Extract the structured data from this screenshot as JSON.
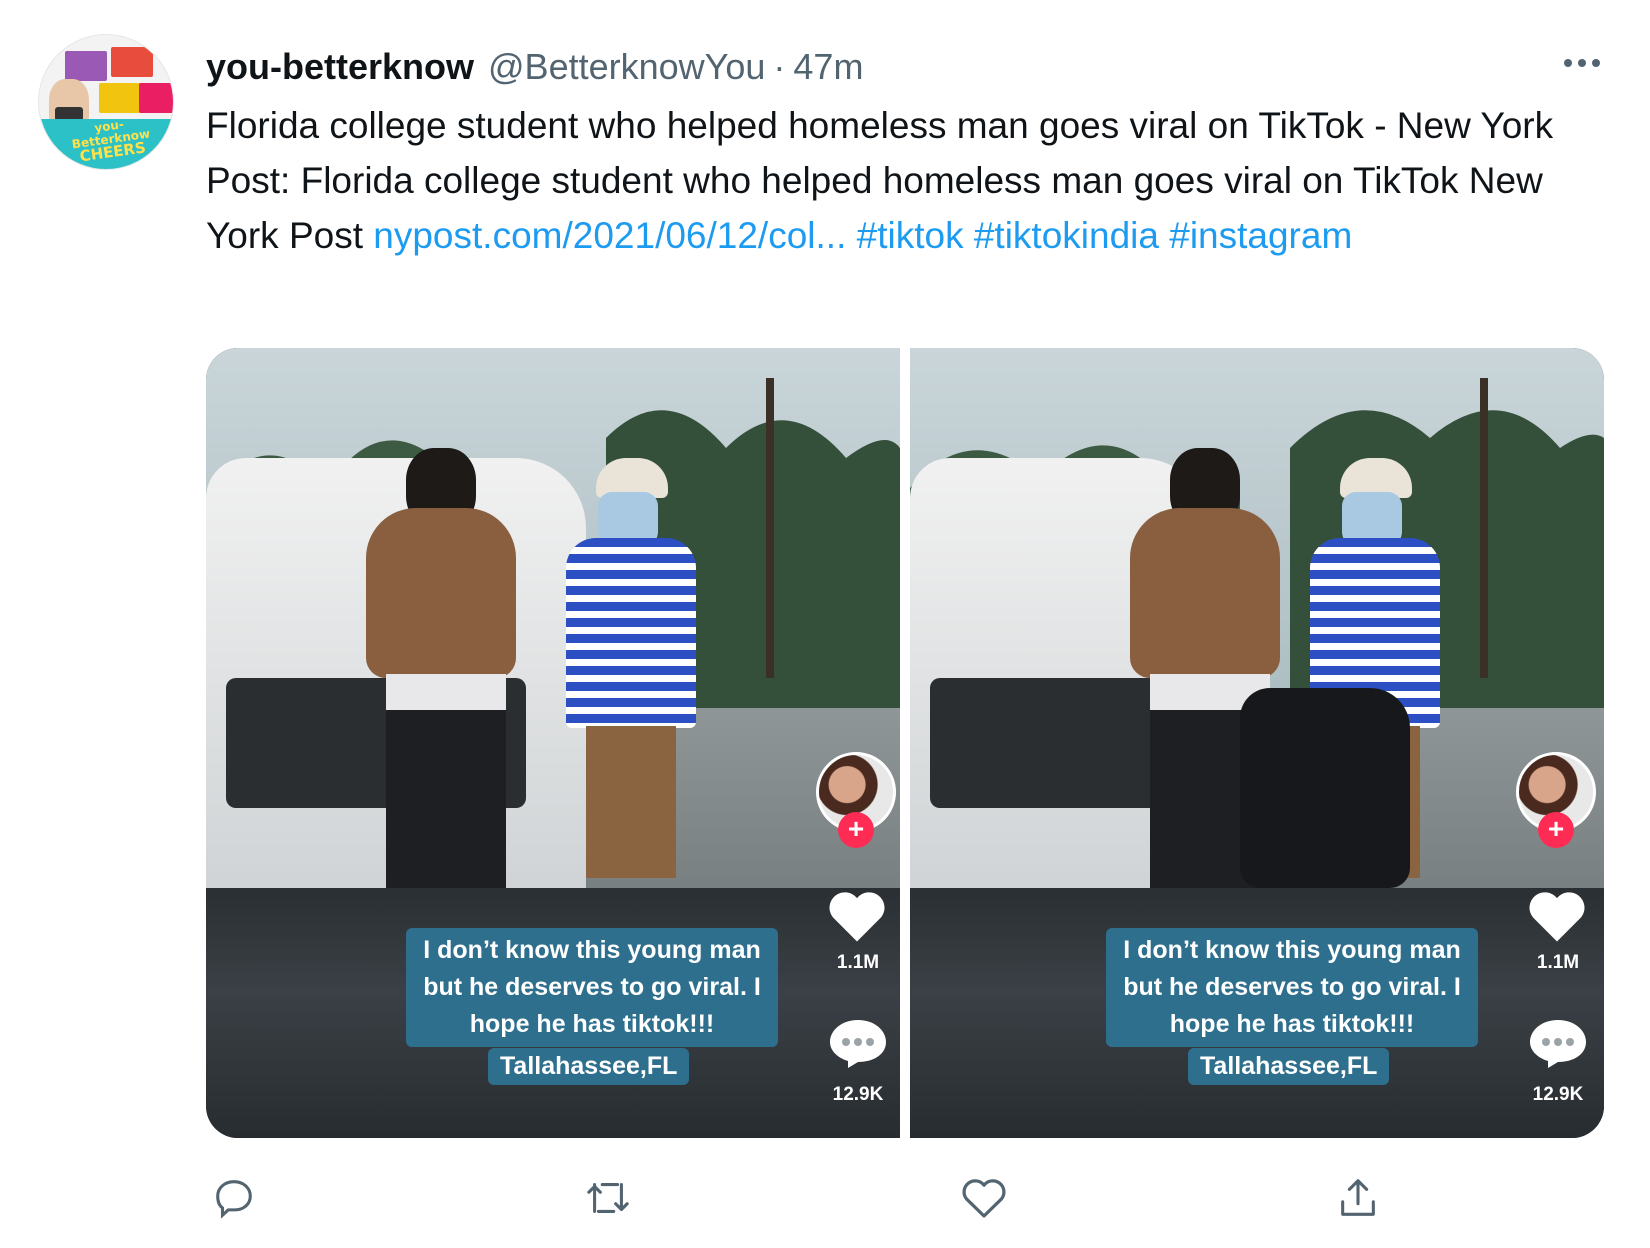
{
  "tweet": {
    "display_name": "you-betterknow",
    "handle": "@BetterknowYou",
    "separator": "·",
    "time": "47m",
    "text_plain": "Florida college student who helped homeless man goes viral on TikTok - New York Post: Florida college student who helped homeless man goes viral on TikTok  New York Post ",
    "link": "nypost.com/2021/06/12/col...",
    "hashtags": [
      "#tiktok",
      "#tiktokindia",
      "#instagram"
    ]
  },
  "avatar": {
    "text_line1": "you-Betterknow",
    "text_line2": "CHEERS"
  },
  "media": {
    "caption": "I don’t know this young man but he deserves to go viral. I hope he has tiktok!!!",
    "location": "Tallahassee,FL",
    "likes": "1.1M",
    "comments": "12.9K",
    "plus": "+"
  },
  "colors": {
    "link": "#1d9bf0",
    "secondary_text": "#536471",
    "caption_bg": "#2e6f8d",
    "tiktok_red": "#fe2c55"
  },
  "icons": {
    "more": "more-horizontal-icon",
    "reply": "reply-icon",
    "retweet": "retweet-icon",
    "like": "heart-icon",
    "share": "share-icon"
  }
}
